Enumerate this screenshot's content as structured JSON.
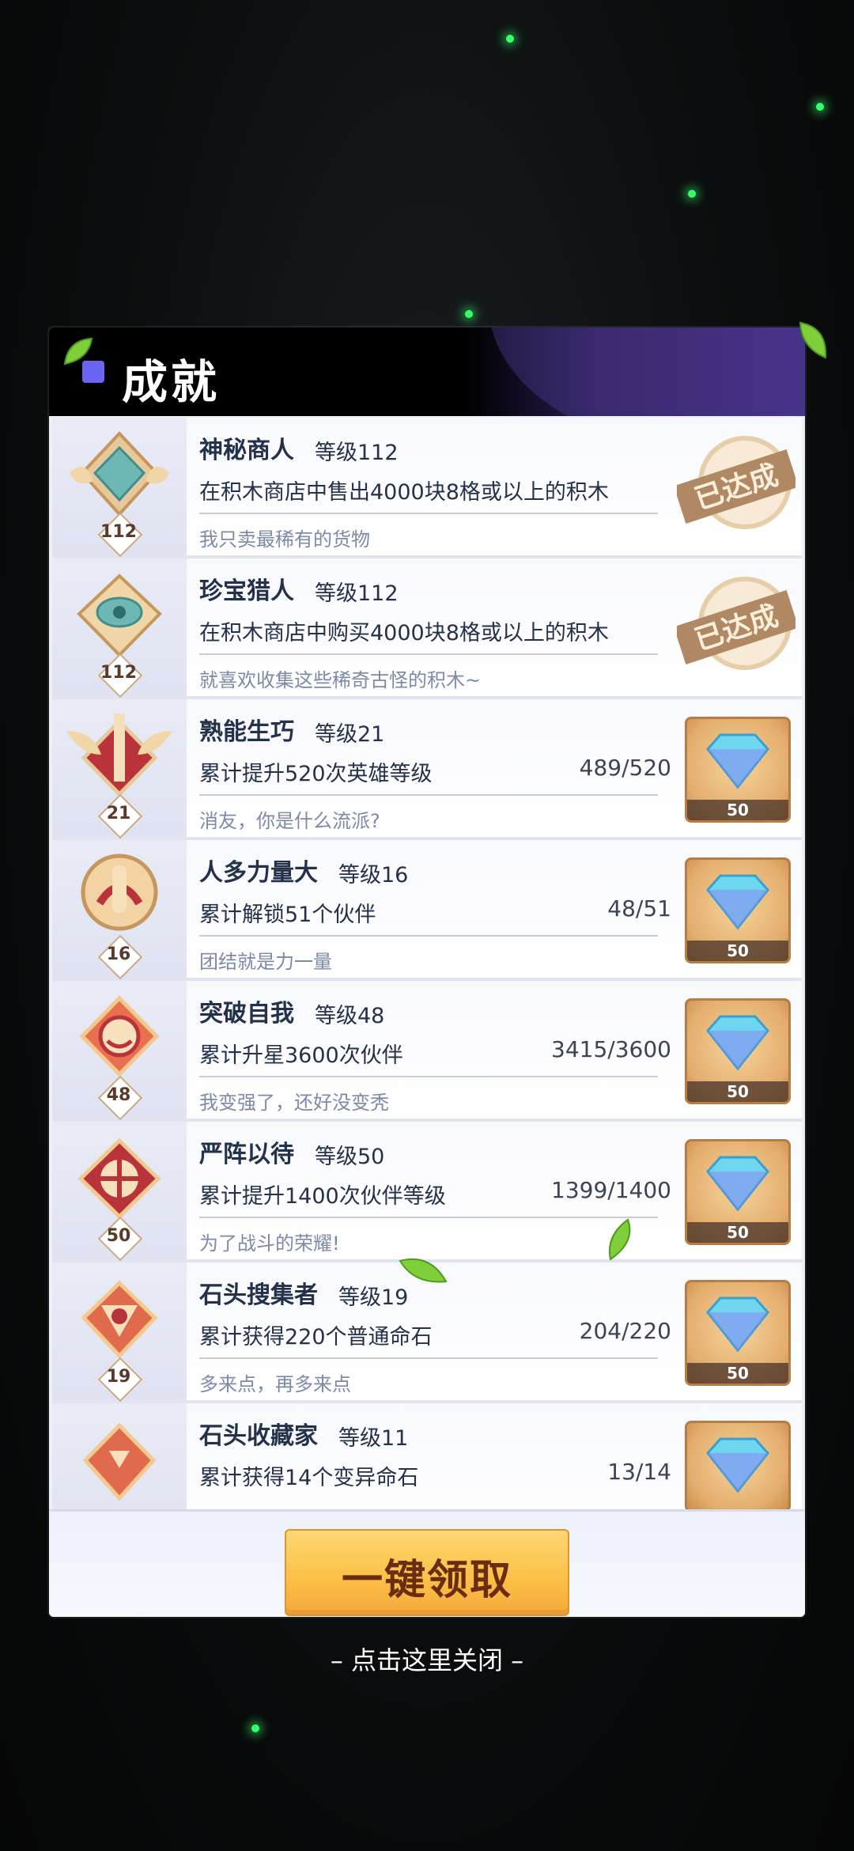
{
  "panel": {
    "title": "成就"
  },
  "achievements": [
    {
      "name": "神秘商人",
      "grade": "等级112",
      "desc": "在积木商店中售出4000块8格或以上的积木",
      "progress": "",
      "flavor": "我只卖最稀有的货物",
      "level": "112",
      "status": "已达成",
      "reward_qty": ""
    },
    {
      "name": "珍宝猎人",
      "grade": "等级112",
      "desc": "在积木商店中购买4000块8格或以上的积木",
      "progress": "",
      "flavor": "就喜欢收集这些稀奇古怪的积木~",
      "level": "112",
      "status": "已达成",
      "reward_qty": ""
    },
    {
      "name": "熟能生巧",
      "grade": "等级21",
      "desc": "累计提升520次英雄等级",
      "progress": "489/520",
      "flavor": "消友，你是什么流派?",
      "level": "21",
      "status": "",
      "reward_qty": "50"
    },
    {
      "name": "人多力量大",
      "grade": "等级16",
      "desc": "累计解锁51个伙伴",
      "progress": "48/51",
      "flavor": "团结就是力一量",
      "level": "16",
      "status": "",
      "reward_qty": "50"
    },
    {
      "name": "突破自我",
      "grade": "等级48",
      "desc": "累计升星3600次伙伴",
      "progress": "3415/3600",
      "flavor": "我变强了，还好没变秃",
      "level": "48",
      "status": "",
      "reward_qty": "50"
    },
    {
      "name": "严阵以待",
      "grade": "等级50",
      "desc": "累计提升1400次伙伴等级",
      "progress": "1399/1400",
      "flavor": "为了战斗的荣耀!",
      "level": "50",
      "status": "",
      "reward_qty": "50"
    },
    {
      "name": "石头搜集者",
      "grade": "等级19",
      "desc": "累计获得220个普通命石",
      "progress": "204/220",
      "flavor": "多来点，再多来点",
      "level": "19",
      "status": "",
      "reward_qty": "50"
    },
    {
      "name": "石头收藏家",
      "grade": "等级11",
      "desc": "累计获得14个变异命石",
      "progress": "13/14",
      "flavor": "",
      "level": "",
      "status": "",
      "reward_qty": ""
    }
  ],
  "footer": {
    "claim_all_label": "一键领取"
  },
  "close_hint": "– 点击这里关闭 –",
  "colors": {
    "accent": "#6b63f2",
    "button": "#fbbf45",
    "text": "#23324a",
    "flavor": "#7c8aa8"
  }
}
